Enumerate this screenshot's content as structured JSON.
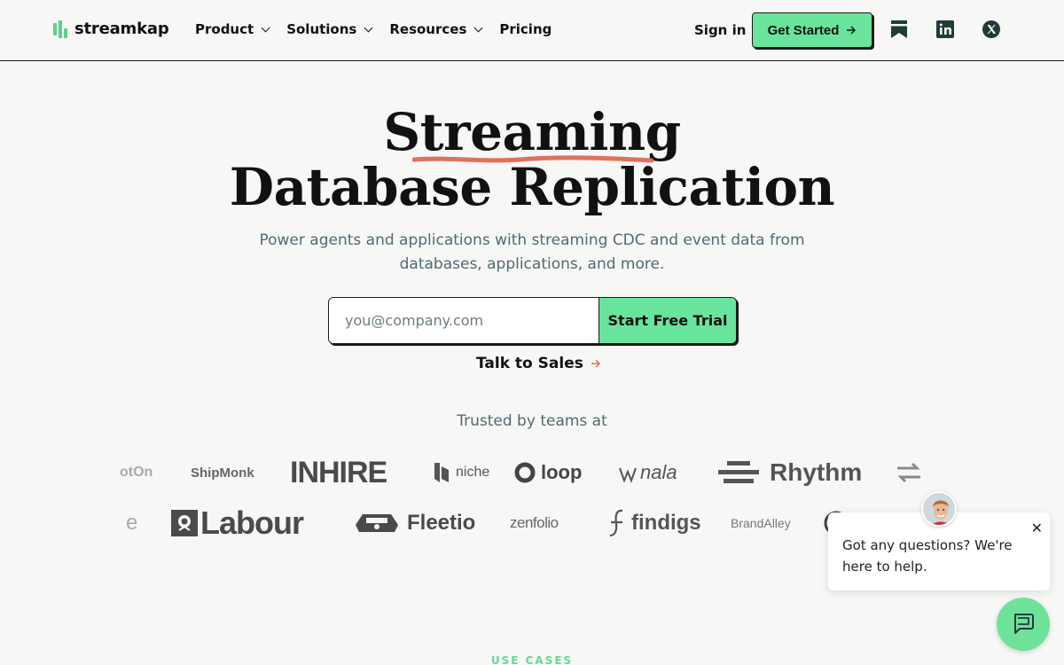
{
  "header": {
    "logo_text": "streamkap",
    "nav": [
      {
        "label": "Product",
        "has_dropdown": true
      },
      {
        "label": "Solutions",
        "has_dropdown": true
      },
      {
        "label": "Resources",
        "has_dropdown": true
      },
      {
        "label": "Pricing",
        "has_dropdown": false
      }
    ],
    "sign_in": "Sign in",
    "get_started": "Get Started",
    "social_icons": [
      "bookmark-icon",
      "linkedin-icon",
      "x-twitter-icon"
    ]
  },
  "hero": {
    "title_line1": "Streaming",
    "title_line2": "Database Replication",
    "subtitle_line1": "Power agents and applications with streaming CDC and event data from",
    "subtitle_line2": "databases, applications, and more.",
    "email_placeholder": "you@company.com",
    "trial_button": "Start Free Trial",
    "talk_to_sales": "Talk to Sales",
    "trusted": "Trusted by teams at"
  },
  "logos_row1": [
    "otOn",
    "ShipMonk",
    "INHIRE",
    "niche",
    "loop",
    "nala",
    "Rhythm"
  ],
  "logos_row2": [
    "e",
    "Labour",
    "Fleetio",
    "zenfolio",
    "findigs",
    "BrandAlley"
  ],
  "chat": {
    "message": "Got any questions? We're here to help.",
    "close": "✕"
  },
  "section_label": "USE CASES",
  "colors": {
    "accent_green": "#69e49c",
    "underline_red": "#e0715c",
    "muted_text": "#4f6a74"
  }
}
